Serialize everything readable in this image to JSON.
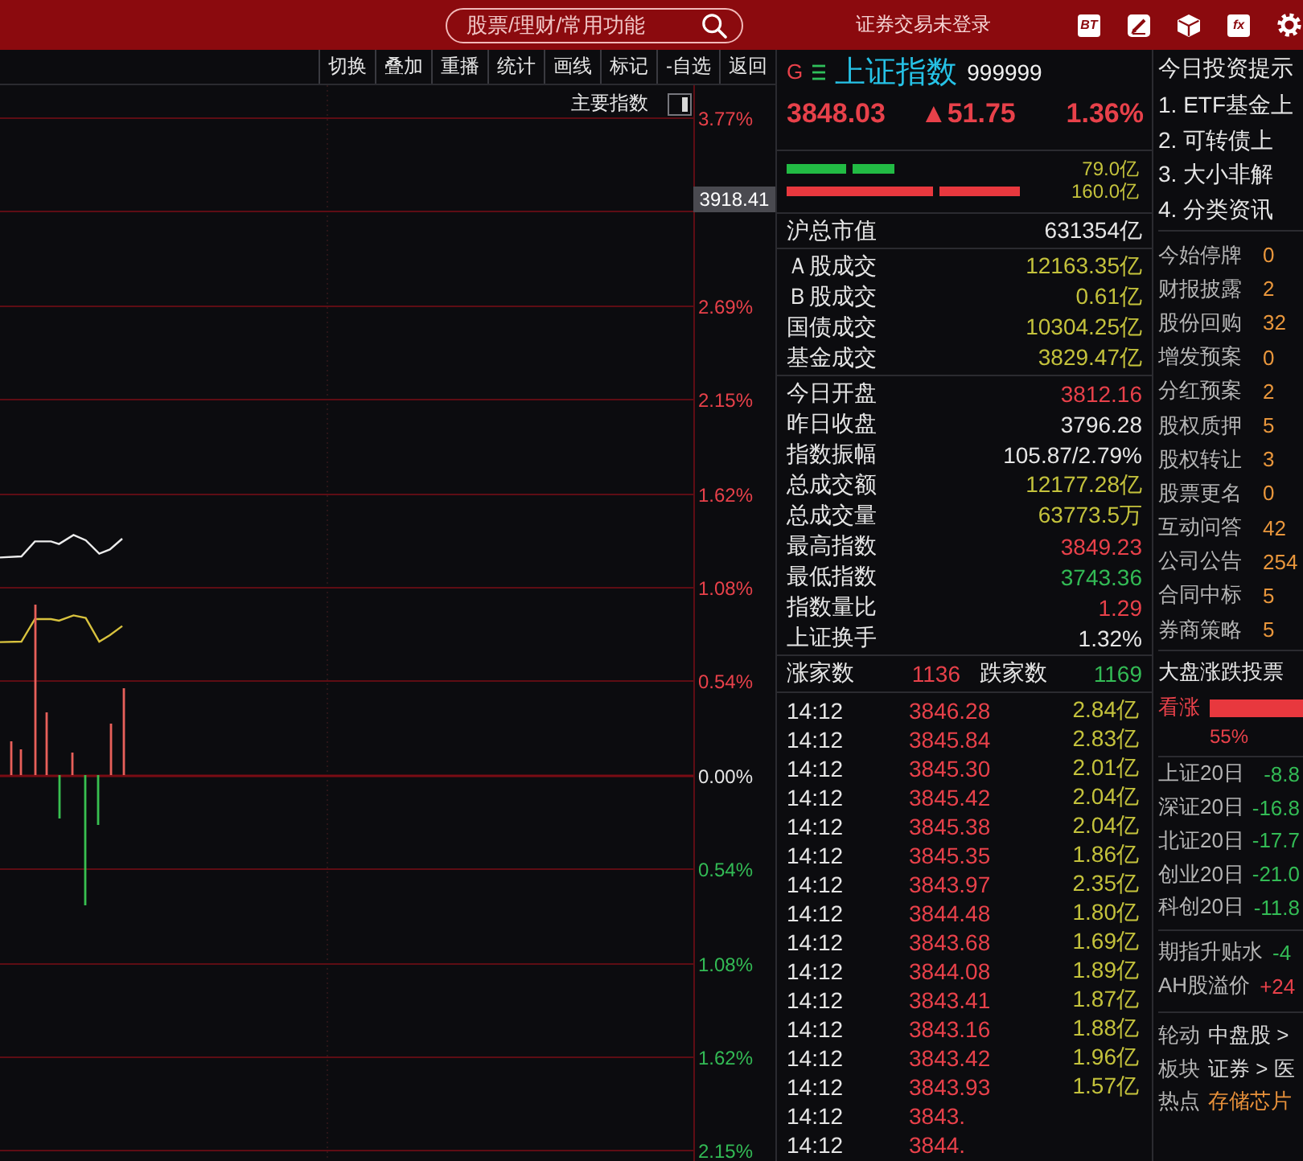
{
  "header": {
    "search": {
      "placeholder": "股票/理财/常用功能"
    },
    "login_status": "证券交易未登录",
    "tools": [
      {
        "kind": "tile",
        "glyph": "BT"
      },
      {
        "kind": "pen"
      },
      {
        "kind": "cube"
      },
      {
        "kind": "tile",
        "glyph": "fx"
      },
      {
        "kind": "gear"
      }
    ]
  },
  "chart_toolbar": {
    "buttons": [
      "切换",
      "叠加",
      "重播",
      "统计",
      "画线",
      "标记",
      "-自选",
      "返回"
    ]
  },
  "chart": {
    "index_menu": "主要指数",
    "y_axis": [
      {
        "label": "3.77%",
        "color": "#e8414a"
      },
      {
        "tag": "3918.41"
      },
      {
        "label": "2.69%",
        "color": "#e8414a"
      },
      {
        "label": "2.15%",
        "color": "#e8414a"
      },
      {
        "label": "1.62%",
        "color": "#e8414a"
      },
      {
        "label": "1.08%",
        "color": "#e8414a"
      },
      {
        "label": "0.54%",
        "color": "#e8414a"
      },
      {
        "label": "0.00%",
        "color": "#e6e6e6"
      },
      {
        "label": "0.54%",
        "color": "#33bb55"
      },
      {
        "label": "1.08%",
        "color": "#33bb55"
      },
      {
        "label": "1.62%",
        "color": "#33bb55"
      },
      {
        "label": "2.15%",
        "color": "#33bb55"
      }
    ]
  },
  "quote": {
    "flag": "G",
    "name": "上证指数",
    "code": "999999",
    "price": "3848.03",
    "change": "▲51.75",
    "change_pct": "1.36%",
    "color": "#e8414a"
  },
  "flow": [
    {
      "color": "#22bb44",
      "value": "79.0亿"
    },
    {
      "color": "#e8383e",
      "value": "160.0亿"
    }
  ],
  "stats": [
    {
      "rows": [
        {
          "label": "沪总市值",
          "value": "631354亿",
          "color": "#e6e6e6"
        }
      ]
    },
    {
      "rows": [
        {
          "label": "Ａ股成交",
          "value": "12163.35亿",
          "color": "#c4c23c"
        },
        {
          "label": "Ｂ股成交",
          "value": "0.61亿",
          "color": "#c4c23c"
        },
        {
          "label": "国债成交",
          "value": "10304.25亿",
          "color": "#c4c23c"
        },
        {
          "label": "基金成交",
          "value": "3829.47亿",
          "color": "#c4c23c"
        }
      ]
    },
    {
      "rows": [
        {
          "label": "今日开盘",
          "value": "3812.16",
          "color": "#e8414a"
        },
        {
          "label": "昨日收盘",
          "value": "3796.28",
          "color": "#e6e6e6"
        },
        {
          "label": "指数振幅",
          "value": "105.87/2.79%",
          "color": "#e6e6e6"
        },
        {
          "label": "总成交额",
          "value": "12177.28亿",
          "color": "#c4c23c"
        },
        {
          "label": "总成交量",
          "value": "63773.5万",
          "color": "#c4c23c"
        },
        {
          "label": "最高指数",
          "value": "3849.23",
          "color": "#e8414a"
        },
        {
          "label": "最低指数",
          "value": "3743.36",
          "color": "#33bb55"
        },
        {
          "label": "指数量比",
          "value": "1.29",
          "color": "#e8414a"
        },
        {
          "label": "上证换手",
          "value": "1.32%",
          "color": "#e6e6e6"
        }
      ]
    }
  ],
  "breadth": {
    "up_label": "涨家数",
    "up_count": "1136",
    "down_label": "跌家数",
    "down_count": "1169"
  },
  "ticks": [
    {
      "time": "14:12",
      "price": "3846.28",
      "volume": "2.84亿",
      "color": "#e8414a"
    },
    {
      "time": "14:12",
      "price": "3845.84",
      "volume": "2.83亿",
      "color": "#e8414a"
    },
    {
      "time": "14:12",
      "price": "3845.30",
      "volume": "2.01亿",
      "color": "#e8414a"
    },
    {
      "time": "14:12",
      "price": "3845.42",
      "volume": "2.04亿",
      "color": "#e8414a"
    },
    {
      "time": "14:12",
      "price": "3845.38",
      "volume": "2.04亿",
      "color": "#e8414a"
    },
    {
      "time": "14:12",
      "price": "3845.35",
      "volume": "1.86亿",
      "color": "#e8414a"
    },
    {
      "time": "14:12",
      "price": "3843.97",
      "volume": "2.35亿",
      "color": "#e8414a"
    },
    {
      "time": "14:12",
      "price": "3844.48",
      "volume": "1.80亿",
      "color": "#e8414a"
    },
    {
      "time": "14:12",
      "price": "3843.68",
      "volume": "1.69亿",
      "color": "#e8414a"
    },
    {
      "time": "14:12",
      "price": "3844.08",
      "volume": "1.89亿",
      "color": "#e8414a"
    },
    {
      "time": "14:12",
      "price": "3843.41",
      "volume": "1.87亿",
      "color": "#e8414a"
    },
    {
      "time": "14:12",
      "price": "3843.16",
      "volume": "1.88亿",
      "color": "#e8414a"
    },
    {
      "time": "14:12",
      "price": "3843.42",
      "volume": "1.96亿",
      "color": "#e8414a"
    },
    {
      "time": "14:12",
      "price": "3843.93",
      "volume": "1.57亿",
      "color": "#e8414a"
    },
    {
      "time": "14:12",
      "price": "3843.",
      "color": "#e8414a"
    },
    {
      "time": "14:12",
      "price": "3844.",
      "color": "#e8414a"
    }
  ],
  "tips": {
    "title": "今日投资提示",
    "items": [
      "1. ETF基金上",
      "2. 可转债上",
      "3. 大小非解",
      "4. 分类资讯"
    ]
  },
  "events": [
    {
      "label": "今始停牌",
      "count": "0"
    },
    {
      "label": "财报披露",
      "count": "2"
    },
    {
      "label": "股份回购",
      "count": "32"
    },
    {
      "label": "增发预案",
      "count": "0"
    },
    {
      "label": "分红预案",
      "count": "2"
    },
    {
      "label": "股权质押",
      "count": "5"
    },
    {
      "label": "股权转让",
      "count": "3"
    },
    {
      "label": "股票更名",
      "count": "0"
    },
    {
      "label": "互动问答",
      "count": "42"
    },
    {
      "label": "公司公告",
      "count": "254"
    },
    {
      "label": "合同中标",
      "count": "5"
    },
    {
      "label": "券商策略",
      "count": "5"
    }
  ],
  "vote": {
    "title": "大盘涨跌投票",
    "label": "看涨",
    "share": "55%"
  },
  "trend_20d": [
    {
      "label": "上证20日",
      "value": "-8.8",
      "color": "#33bb55"
    },
    {
      "label": "深证20日",
      "value": "-16.8",
      "color": "#33bb55"
    },
    {
      "label": "北证20日",
      "value": "-17.7",
      "color": "#33bb55"
    },
    {
      "label": "创业20日",
      "value": "-21.0",
      "color": "#33bb55"
    },
    {
      "label": "科创20日",
      "value": "-11.8",
      "color": "#33bb55"
    }
  ],
  "premium": [
    {
      "label": "期指升贴水",
      "value": "-4",
      "color": "#33bb55"
    },
    {
      "label": "AH股溢价",
      "value": "+24",
      "color": "#e8414a"
    }
  ],
  "hot": [
    {
      "label": "轮动",
      "value": "中盘股 >",
      "color": "#d8d8d8"
    },
    {
      "label": "板块",
      "value": "证券 > 医",
      "color": "#d8d8d8"
    },
    {
      "label": "热点",
      "value": "存储芯片",
      "color": "#e8913a"
    }
  ]
}
